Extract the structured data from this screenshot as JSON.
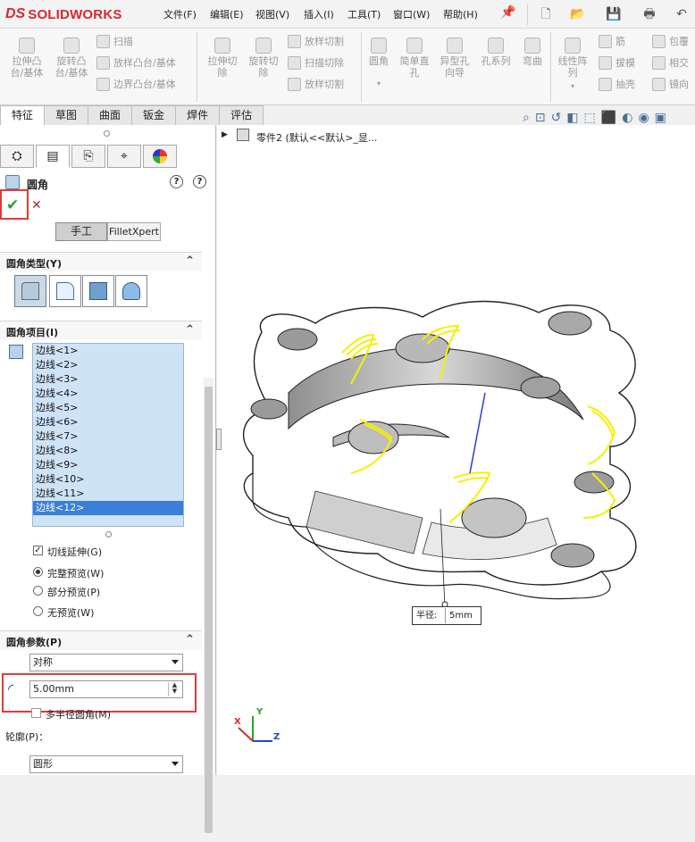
{
  "app": {
    "brand_ds": "DS",
    "brand_name": "SOLIDWORKS"
  },
  "menu": [
    "文件(F)",
    "编辑(E)",
    "视图(V)",
    "插入(I)",
    "工具(T)",
    "窗口(W)",
    "帮助(H)"
  ],
  "toolbar_large": [
    {
      "label": "拉伸凸\n台/基体"
    },
    {
      "label": "旋转凸\n台/基体"
    },
    {
      "label": "拉伸切\n除"
    },
    {
      "label": "旋转切\n除"
    },
    {
      "label": "圆角"
    },
    {
      "label": "简单直\n孔"
    },
    {
      "label": "异型孔\n向导"
    },
    {
      "label": "孔系列"
    },
    {
      "label": "弯曲"
    },
    {
      "label": "线性阵\n列"
    }
  ],
  "toolbar_small": {
    "col1": [
      "扫描",
      "放样凸台/基体",
      "边界凸台/基体"
    ],
    "col2": [
      "放样切割",
      "扫描切除",
      "放样切割"
    ],
    "col3": [
      "筋",
      "拔模",
      "抽壳"
    ],
    "col4": [
      "包覆",
      "相交",
      "镜向"
    ]
  },
  "tabs": [
    "特征",
    "草图",
    "曲面",
    "钣金",
    "焊件",
    "评估"
  ],
  "active_tab": "特征",
  "feature": {
    "title": "圆角",
    "help1": "?",
    "help2": "?",
    "mode_manual": "手工",
    "mode_expert": "FilletXpert"
  },
  "sections": {
    "type": "圆角类型(Y)",
    "items": "圆角项目(I)",
    "params": "圆角参数(P)"
  },
  "edges": [
    "边线<1>",
    "边线<2>",
    "边线<3>",
    "边线<4>",
    "边线<5>",
    "边线<6>",
    "边线<7>",
    "边线<8>",
    "边线<9>",
    "边线<10>",
    "边线<11>",
    "边线<12>"
  ],
  "selected_edge": "边线<12>",
  "options": {
    "tangent": "切线延伸(G)",
    "tangent_checked": true,
    "full_preview": "完整预览(W)",
    "partial_preview": "部分预览(P)",
    "no_preview": "无预览(W)"
  },
  "params": {
    "mode": "对称",
    "radius": "5.00mm",
    "multi_radius": "多半径圆角(M)",
    "profile_label": "轮廓(P)：",
    "profile": "圆形"
  },
  "tree": {
    "part": "零件2  (默认<<默认>_显..."
  },
  "callout": {
    "label": "半径:",
    "value": "5mm"
  },
  "axes": {
    "x": "X",
    "y": "Y",
    "z": "Z"
  },
  "colors": {
    "accent_red": "#d8282f",
    "selection_blue": "#3b7fd9",
    "preview_yellow": "#f5f000"
  }
}
